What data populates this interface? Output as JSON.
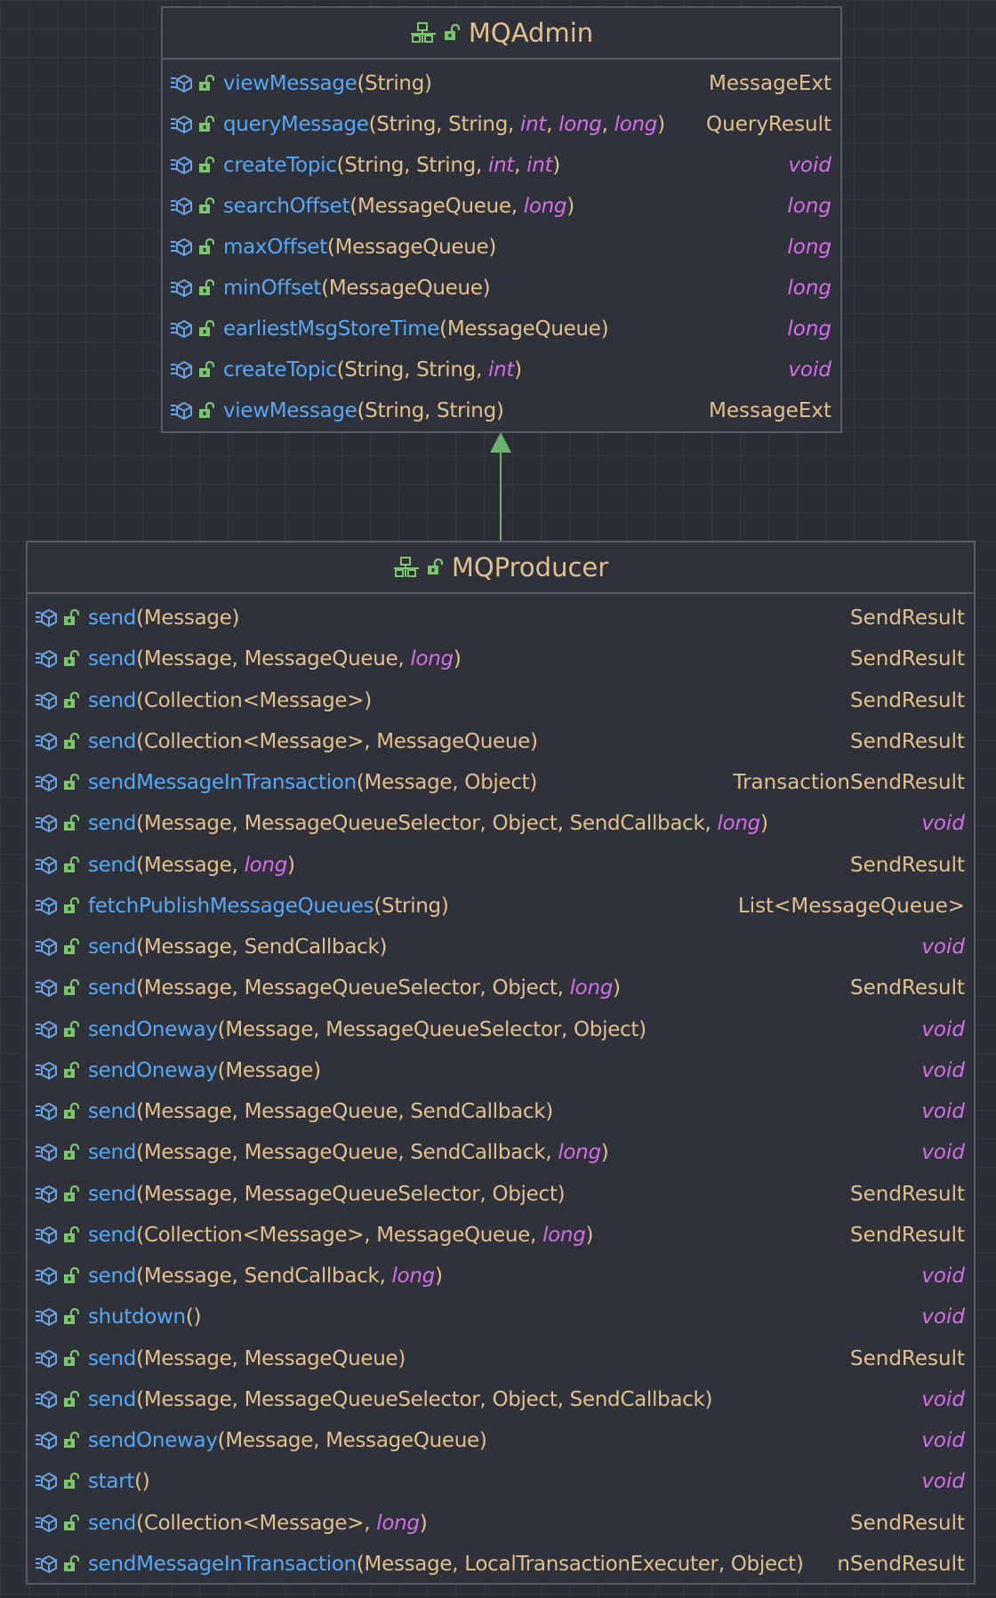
{
  "colors": {
    "background": "#2b2e34",
    "node_fill": "#2f323a",
    "node_border": "#585c64",
    "class_name": "#e2c08d",
    "method_name": "#56a8f5",
    "type_text": "#e2c08d",
    "primitive_type": "#d36de8",
    "arrow": "#6db36d",
    "method_icon": "#6aa3e6",
    "visibility_icon": "#7bc56b"
  },
  "icons": {
    "class_header": [
      "interface-icon",
      "public-lock-icon"
    ],
    "member": [
      "abstract-method-icon",
      "public-lock-icon"
    ]
  },
  "classes": [
    {
      "name": "MQAdmin",
      "methods": [
        {
          "name": "viewMessage",
          "params": [
            {
              "t": "String"
            }
          ],
          "ret": "MessageExt"
        },
        {
          "name": "queryMessage",
          "params": [
            {
              "t": "String"
            },
            {
              "t": "String"
            },
            {
              "t": "int",
              "p": true
            },
            {
              "t": "long",
              "p": true
            },
            {
              "t": "long",
              "p": true
            }
          ],
          "ret": "QueryResult"
        },
        {
          "name": "createTopic",
          "params": [
            {
              "t": "String"
            },
            {
              "t": "String"
            },
            {
              "t": "int",
              "p": true
            },
            {
              "t": "int",
              "p": true
            }
          ],
          "ret": "void",
          "retP": true
        },
        {
          "name": "searchOffset",
          "params": [
            {
              "t": "MessageQueue"
            },
            {
              "t": "long",
              "p": true
            }
          ],
          "ret": "long",
          "retP": true
        },
        {
          "name": "maxOffset",
          "params": [
            {
              "t": "MessageQueue"
            }
          ],
          "ret": "long",
          "retP": true
        },
        {
          "name": "minOffset",
          "params": [
            {
              "t": "MessageQueue"
            }
          ],
          "ret": "long",
          "retP": true
        },
        {
          "name": "earliestMsgStoreTime",
          "params": [
            {
              "t": "MessageQueue"
            }
          ],
          "ret": "long",
          "retP": true
        },
        {
          "name": "createTopic",
          "params": [
            {
              "t": "String"
            },
            {
              "t": "String"
            },
            {
              "t": "int",
              "p": true
            }
          ],
          "ret": "void",
          "retP": true
        },
        {
          "name": "viewMessage",
          "params": [
            {
              "t": "String"
            },
            {
              "t": "String"
            }
          ],
          "ret": "MessageExt"
        }
      ]
    },
    {
      "name": "MQProducer",
      "methods": [
        {
          "name": "send",
          "params": [
            {
              "t": "Message"
            }
          ],
          "ret": "SendResult"
        },
        {
          "name": "send",
          "params": [
            {
              "t": "Message"
            },
            {
              "t": "MessageQueue"
            },
            {
              "t": "long",
              "p": true
            }
          ],
          "ret": "SendResult"
        },
        {
          "name": "send",
          "params": [
            {
              "t": "Collection<Message>"
            }
          ],
          "ret": "SendResult"
        },
        {
          "name": "send",
          "params": [
            {
              "t": "Collection<Message>"
            },
            {
              "t": "MessageQueue"
            }
          ],
          "ret": "SendResult"
        },
        {
          "name": "sendMessageInTransaction",
          "params": [
            {
              "t": "Message"
            },
            {
              "t": "Object"
            }
          ],
          "ret": "TransactionSendResult"
        },
        {
          "name": "send",
          "params": [
            {
              "t": "Message"
            },
            {
              "t": "MessageQueueSelector"
            },
            {
              "t": "Object"
            },
            {
              "t": "SendCallback"
            },
            {
              "t": "long",
              "p": true
            }
          ],
          "ret": "void",
          "retP": true
        },
        {
          "name": "send",
          "params": [
            {
              "t": "Message"
            },
            {
              "t": "long",
              "p": true
            }
          ],
          "ret": "SendResult"
        },
        {
          "name": "fetchPublishMessageQueues",
          "params": [
            {
              "t": "String"
            }
          ],
          "ret": "List<MessageQueue>"
        },
        {
          "name": "send",
          "params": [
            {
              "t": "Message"
            },
            {
              "t": "SendCallback"
            }
          ],
          "ret": "void",
          "retP": true
        },
        {
          "name": "send",
          "params": [
            {
              "t": "Message"
            },
            {
              "t": "MessageQueueSelector"
            },
            {
              "t": "Object"
            },
            {
              "t": "long",
              "p": true
            }
          ],
          "ret": "SendResult"
        },
        {
          "name": "sendOneway",
          "params": [
            {
              "t": "Message"
            },
            {
              "t": "MessageQueueSelector"
            },
            {
              "t": "Object"
            }
          ],
          "ret": "void",
          "retP": true
        },
        {
          "name": "sendOneway",
          "params": [
            {
              "t": "Message"
            }
          ],
          "ret": "void",
          "retP": true
        },
        {
          "name": "send",
          "params": [
            {
              "t": "Message"
            },
            {
              "t": "MessageQueue"
            },
            {
              "t": "SendCallback"
            }
          ],
          "ret": "void",
          "retP": true
        },
        {
          "name": "send",
          "params": [
            {
              "t": "Message"
            },
            {
              "t": "MessageQueue"
            },
            {
              "t": "SendCallback"
            },
            {
              "t": "long",
              "p": true
            }
          ],
          "ret": "void",
          "retP": true
        },
        {
          "name": "send",
          "params": [
            {
              "t": "Message"
            },
            {
              "t": "MessageQueueSelector"
            },
            {
              "t": "Object"
            }
          ],
          "ret": "SendResult"
        },
        {
          "name": "send",
          "params": [
            {
              "t": "Collection<Message>"
            },
            {
              "t": "MessageQueue"
            },
            {
              "t": "long",
              "p": true
            }
          ],
          "ret": "SendResult"
        },
        {
          "name": "send",
          "params": [
            {
              "t": "Message"
            },
            {
              "t": "SendCallback"
            },
            {
              "t": "long",
              "p": true
            }
          ],
          "ret": "void",
          "retP": true
        },
        {
          "name": "shutdown",
          "params": [],
          "ret": "void",
          "retP": true
        },
        {
          "name": "send",
          "params": [
            {
              "t": "Message"
            },
            {
              "t": "MessageQueue"
            }
          ],
          "ret": "SendResult"
        },
        {
          "name": "send",
          "params": [
            {
              "t": "Message"
            },
            {
              "t": "MessageQueueSelector"
            },
            {
              "t": "Object"
            },
            {
              "t": "SendCallback"
            }
          ],
          "ret": "void",
          "retP": true
        },
        {
          "name": "sendOneway",
          "params": [
            {
              "t": "Message"
            },
            {
              "t": "MessageQueue"
            }
          ],
          "ret": "void",
          "retP": true
        },
        {
          "name": "start",
          "params": [],
          "ret": "void",
          "retP": true
        },
        {
          "name": "send",
          "params": [
            {
              "t": "Collection<Message>"
            },
            {
              "t": "long",
              "p": true
            }
          ],
          "ret": "SendResult"
        },
        {
          "name": "sendMessageInTransaction",
          "params": [
            {
              "t": "Message"
            },
            {
              "t": "LocalTransactionExecuter"
            },
            {
              "t": "Object"
            }
          ],
          "ret": "nSendResult"
        }
      ]
    }
  ],
  "relations": [
    {
      "type": "extends",
      "from": "MQProducer",
      "to": "MQAdmin"
    }
  ]
}
